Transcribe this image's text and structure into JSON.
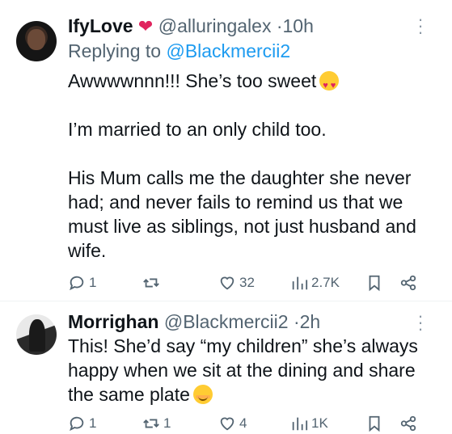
{
  "tweets": [
    {
      "author_name": "IfyLove",
      "handle": "@alluringalex",
      "separator": "·",
      "time": "10h",
      "reply_prefix": "Replying to",
      "reply_to": "@Blackmercii2",
      "lines": [
        "Awwwwnnn!!! She’s too sweet",
        "I’m married to an only child too.",
        "His Mum calls me the daughter she never had; and never fails to remind us that we must live as siblings, not just husband and wife."
      ],
      "counts": {
        "replies": "1",
        "reposts": "",
        "likes": "32",
        "views": "2.7K"
      }
    },
    {
      "author_name": "Morrighan",
      "handle": "@Blackmercii2",
      "separator": "·",
      "time": "2h",
      "text": "This! She’d say “my children” she’s always happy when we sit at the dining and share the same plate",
      "counts": {
        "replies": "1",
        "reposts": "1",
        "likes": "4",
        "views": "1K"
      }
    }
  ],
  "icons": {
    "verified_heart": "red-heart-emoji",
    "emoji_1": "heart-eyes-emoji",
    "emoji_2": "smiling-face-emoji"
  },
  "colors": {
    "text": "#0f1419",
    "secondary": "#536471",
    "link": "#1d9bf0",
    "heart": "#e0245e"
  }
}
